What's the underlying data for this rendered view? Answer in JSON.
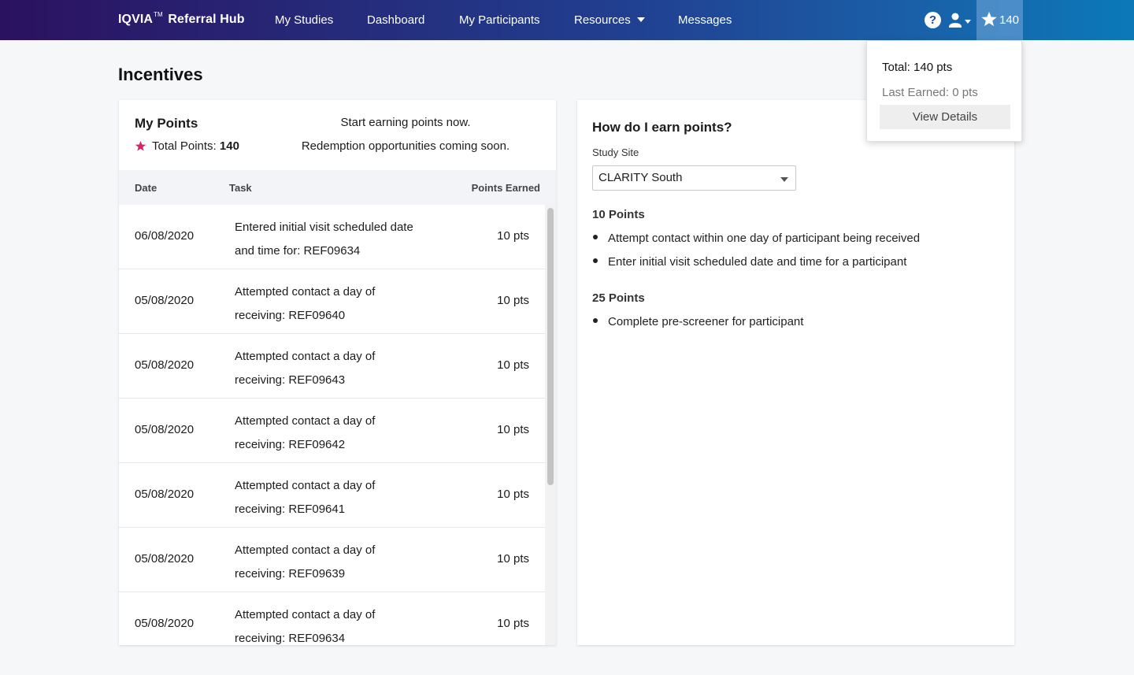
{
  "brand": {
    "name": "IQVIA",
    "tm": "TM",
    "product": "Referral Hub"
  },
  "nav": {
    "my_studies": "My Studies",
    "dashboard": "Dashboard",
    "my_participants": "My Participants",
    "resources": "Resources",
    "messages": "Messages",
    "help_symbol": "?",
    "points_count": "140"
  },
  "page": {
    "title": "Incentives"
  },
  "my_points": {
    "title": "My Points",
    "total_label": "Total Points: ",
    "total_value": "140",
    "message_line1": "Start earning points now.",
    "message_line2": "Redemption opportunities coming soon.",
    "columns": {
      "date": "Date",
      "task": "Task",
      "points": "Points Earned"
    },
    "rows": [
      {
        "date": "06/08/2020",
        "task": "Entered initial visit scheduled date and time for: REF09634",
        "points": "10 pts"
      },
      {
        "date": "05/08/2020",
        "task": "Attempted contact a day of receiving: REF09640",
        "points": "10 pts"
      },
      {
        "date": "05/08/2020",
        "task": "Attempted contact a day of receiving: REF09643",
        "points": "10 pts"
      },
      {
        "date": "05/08/2020",
        "task": "Attempted contact a day of receiving: REF09642",
        "points": "10 pts"
      },
      {
        "date": "05/08/2020",
        "task": "Attempted contact a day of receiving: REF09641",
        "points": "10 pts"
      },
      {
        "date": "05/08/2020",
        "task": "Attempted contact a day of receiving: REF09639",
        "points": "10 pts"
      },
      {
        "date": "05/08/2020",
        "task": "Attempted contact a day of receiving: REF09634",
        "points": "10 pts"
      }
    ]
  },
  "earn": {
    "title": "How do I earn points?",
    "site_label": "Study Site",
    "site_value": "CLARITY South",
    "tier1": {
      "title": "10 Points",
      "items": [
        "Attempt contact within one day of participant being received",
        "Enter initial visit scheduled date and time for a participant"
      ]
    },
    "tier2": {
      "title": "25 Points",
      "items": [
        "Complete pre-screener for participant"
      ]
    }
  },
  "popover": {
    "total": "Total: 140 pts",
    "last_earned": "Last Earned: 0 pts",
    "button": "View Details"
  },
  "colors": {
    "accent_star": "#d8246b",
    "nav_start": "#2b1260",
    "nav_end": "#0b79b8"
  },
  "icons": {
    "help": "help-icon",
    "user": "user-icon",
    "star": "star-icon"
  }
}
